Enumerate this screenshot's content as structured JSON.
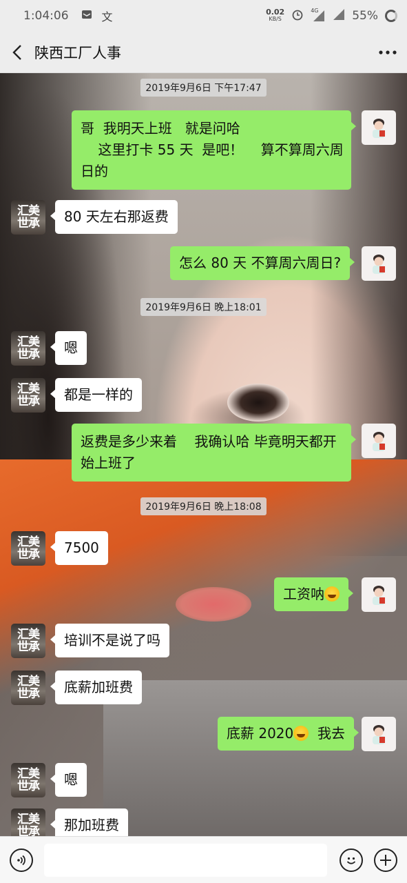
{
  "status_bar": {
    "time": "1:04:06",
    "mail_icon": "mail-icon",
    "text_icon": "文",
    "net_speed_value": "0.02",
    "net_speed_unit": "KB/S",
    "alarm_icon": "alarm-icon",
    "network": "4G",
    "battery": "55%"
  },
  "header": {
    "back_icon": "chevron-left-icon",
    "title": "陕西工厂人事",
    "more_icon": "more-icon"
  },
  "messages": [
    {
      "type": "timestamp",
      "text": "2019年9月6日 下午17:47"
    },
    {
      "type": "me",
      "lines": [
        "哥  我明天上班   就是问哈",
        "    这里打卡 55 天  是吧！    算不算周六周",
        "日的"
      ]
    },
    {
      "type": "them",
      "text": "80 天左右那返费"
    },
    {
      "type": "me",
      "text": "怎么 80 天  不算周六周日?"
    },
    {
      "type": "timestamp",
      "text": "2019年9月6日 晚上18:01"
    },
    {
      "type": "them",
      "text": "嗯"
    },
    {
      "type": "them",
      "text": "都是一样的"
    },
    {
      "type": "me",
      "lines": [
        "返费是多少来着    我确认哈 毕竟明天都开",
        "始上班了"
      ]
    },
    {
      "type": "timestamp",
      "text": "2019年9月6日 晚上18:08"
    },
    {
      "type": "them",
      "text": "7500"
    },
    {
      "type": "me",
      "text": "工资呐",
      "emoji": "laugh-cry-emoji"
    },
    {
      "type": "them",
      "text": "培训不是说了吗"
    },
    {
      "type": "them",
      "text": "底薪加班费"
    },
    {
      "type": "me",
      "text_before": "底薪 2020",
      "emoji": "crying-emoji",
      "text_after": "  我去"
    },
    {
      "type": "them",
      "text": "嗯"
    },
    {
      "type": "them",
      "text": "那加班费"
    }
  ],
  "avatars": {
    "me": "user-avatar",
    "them_text": "汇美\n世承"
  },
  "input_bar": {
    "voice_icon": "voice-icon",
    "input_value": "",
    "emoji_icon": "emoji-icon",
    "plus_icon": "plus-icon"
  },
  "colors": {
    "my_bubble": "#95ec69",
    "their_bubble": "#ffffff",
    "bar_bg": "#ededed"
  }
}
